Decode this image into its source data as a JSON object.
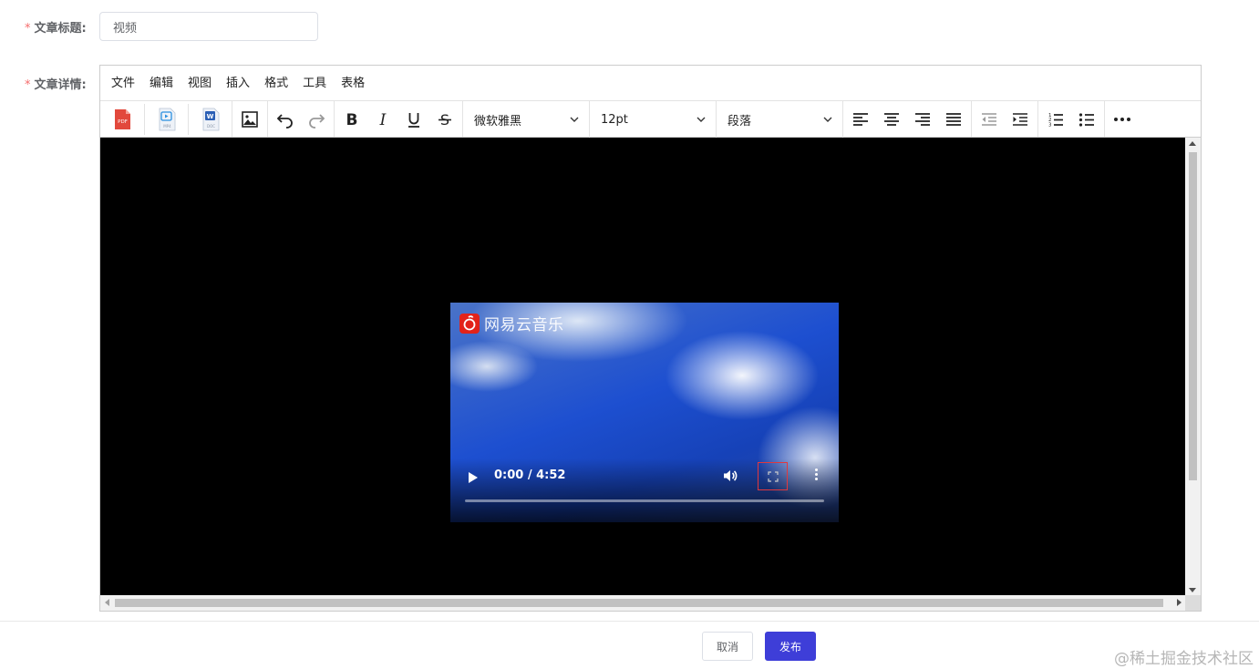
{
  "form": {
    "title_label": "文章标题:",
    "title_value": "视频",
    "detail_label": "文章详情:",
    "required_mark": "*"
  },
  "editor": {
    "menus": [
      "文件",
      "编辑",
      "视图",
      "插入",
      "格式",
      "工具",
      "表格"
    ],
    "toolbar": {
      "icons": [
        "pdf-icon",
        "mp4-icon",
        "doc-icon",
        "image-icon",
        "undo-icon",
        "redo-icon",
        "bold-icon",
        "italic-icon",
        "underline-icon",
        "strikethrough-icon"
      ],
      "font_family": "微软雅黑",
      "font_size": "12pt",
      "block_format": "段落",
      "align_icons": [
        "align-left-icon",
        "align-center-icon",
        "align-right-icon",
        "align-justify-icon"
      ],
      "indent_icons": [
        "outdent-icon",
        "indent-icon"
      ],
      "list_icons": [
        "numbered-list-icon",
        "bullet-list-icon"
      ],
      "more_icon": "more-icon"
    },
    "video": {
      "logo_text": "网易云音乐",
      "time": "0:00 / 4:52",
      "progress": 0
    }
  },
  "footer": {
    "cancel_label": "取消",
    "publish_label": "发布",
    "watermark": "@稀土掘金技术社区"
  },
  "colors": {
    "primary": "#3e3ed8",
    "required": "#f56c6c",
    "logo_red": "#e2231a"
  }
}
